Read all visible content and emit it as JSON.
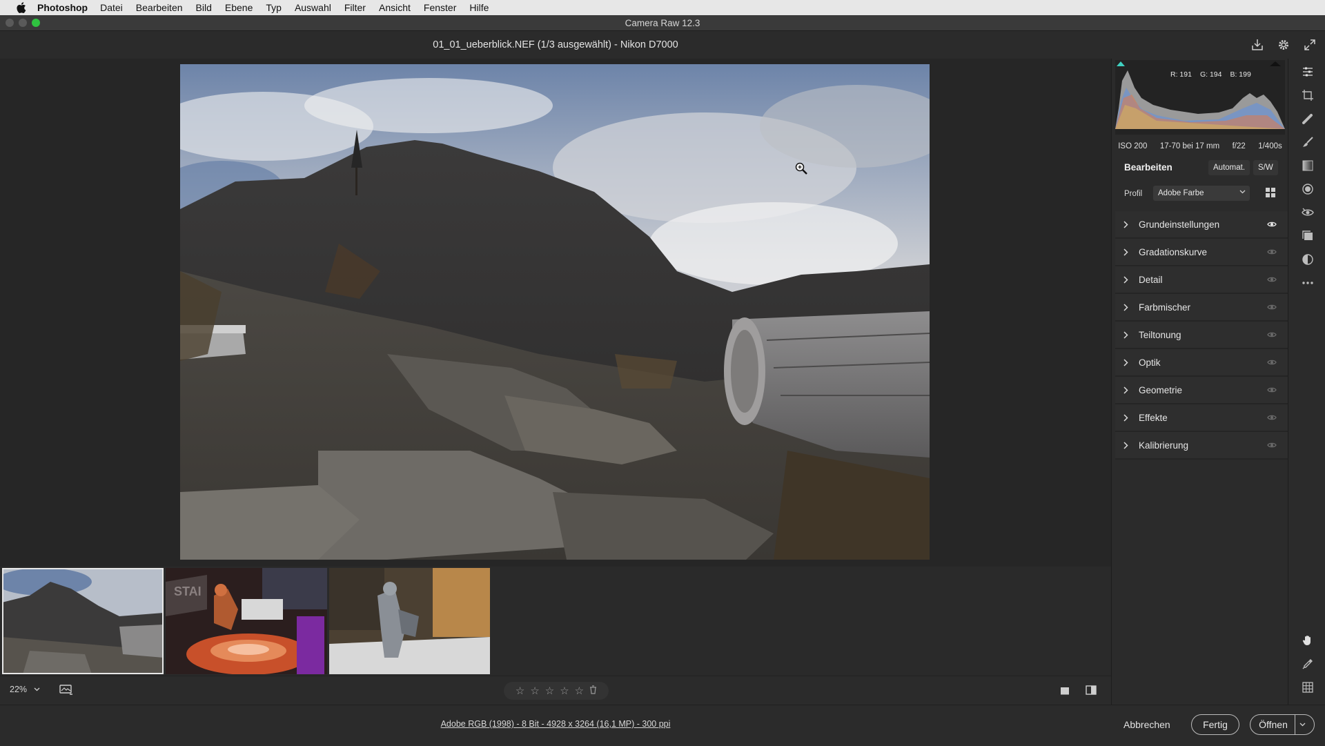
{
  "menubar": {
    "app": "Photoshop",
    "items": [
      "Datei",
      "Bearbeiten",
      "Bild",
      "Ebene",
      "Typ",
      "Auswahl",
      "Filter",
      "Ansicht",
      "Fenster",
      "Hilfe"
    ]
  },
  "window": {
    "title": "Camera Raw 12.3"
  },
  "header": {
    "filename": "01_01_ueberblick.NEF (1/3 ausgewählt) - Nikon D7000",
    "icons": [
      "save-icon",
      "settings-icon",
      "fullscreen-icon"
    ]
  },
  "histogram": {
    "r": "R: 191",
    "g": "G: 194",
    "b": "B: 199"
  },
  "exif": {
    "iso": "ISO 200",
    "lens": "17-70 bei 17 mm",
    "aperture": "f/22",
    "shutter": "1/400s"
  },
  "edit": {
    "title": "Bearbeiten",
    "auto": "Automat.",
    "bw": "S/W",
    "profile_label": "Profil",
    "profile_value": "Adobe Farbe"
  },
  "sections": [
    {
      "label": "Grundeinstellungen",
      "active": true
    },
    {
      "label": "Gradationskurve",
      "active": false
    },
    {
      "label": "Detail",
      "active": false
    },
    {
      "label": "Farbmischer",
      "active": false
    },
    {
      "label": "Teiltonung",
      "active": false
    },
    {
      "label": "Optik",
      "active": false
    },
    {
      "label": "Geometrie",
      "active": false
    },
    {
      "label": "Effekte",
      "active": false
    },
    {
      "label": "Kalibrierung",
      "active": false
    }
  ],
  "filmstrip": {
    "count": 3,
    "selected_index": 0
  },
  "bottombar": {
    "zoom": "22%",
    "rating_stars": 0
  },
  "footer": {
    "info": "Adobe RGB (1998) - 8 Bit - 4928 x 3264 (16,1 MP) - 300 ppi",
    "cancel": "Abbrechen",
    "done": "Fertig",
    "open": "Öffnen"
  },
  "tools": [
    "edit-sliders-icon",
    "crop-icon",
    "spot-heal-icon",
    "adjustment-brush-icon",
    "graduated-filter-icon",
    "radial-filter-icon",
    "red-eye-icon",
    "snapshots-icon",
    "presets-icon",
    "more-icon",
    "hand-icon",
    "color-sampler-icon",
    "grid-icon"
  ]
}
